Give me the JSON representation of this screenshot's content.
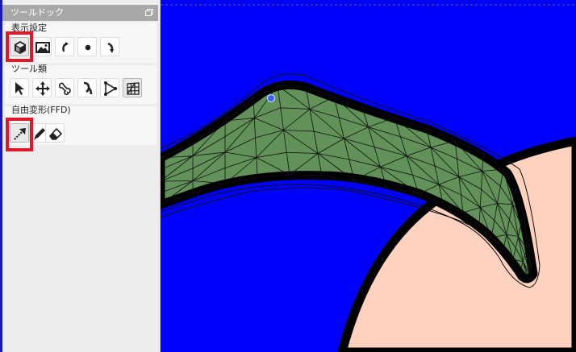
{
  "dock": {
    "title": "ツールドック",
    "sections": {
      "display": "表示設定",
      "tools": "ツール類",
      "ffd": "自由変形(FFD)"
    },
    "display_buttons": [
      "cube-icon",
      "image-icon",
      "undo-icon",
      "dot-icon",
      "redo-icon"
    ],
    "tool_buttons": [
      "cursor-icon",
      "move-icon",
      "bone-icon",
      "joint-icon",
      "vertex-icon",
      "mesh-icon"
    ],
    "ffd_buttons": [
      "ffd-arrow-icon",
      "pen-icon",
      "eraser-icon"
    ]
  },
  "colors": {
    "canvas_bg": "#0000ff",
    "shape_fill": "#62915a",
    "skin_fill": "#ffd1bf",
    "outline": "#000000",
    "highlight": "#e0192a",
    "handle": "#3a62ff"
  }
}
